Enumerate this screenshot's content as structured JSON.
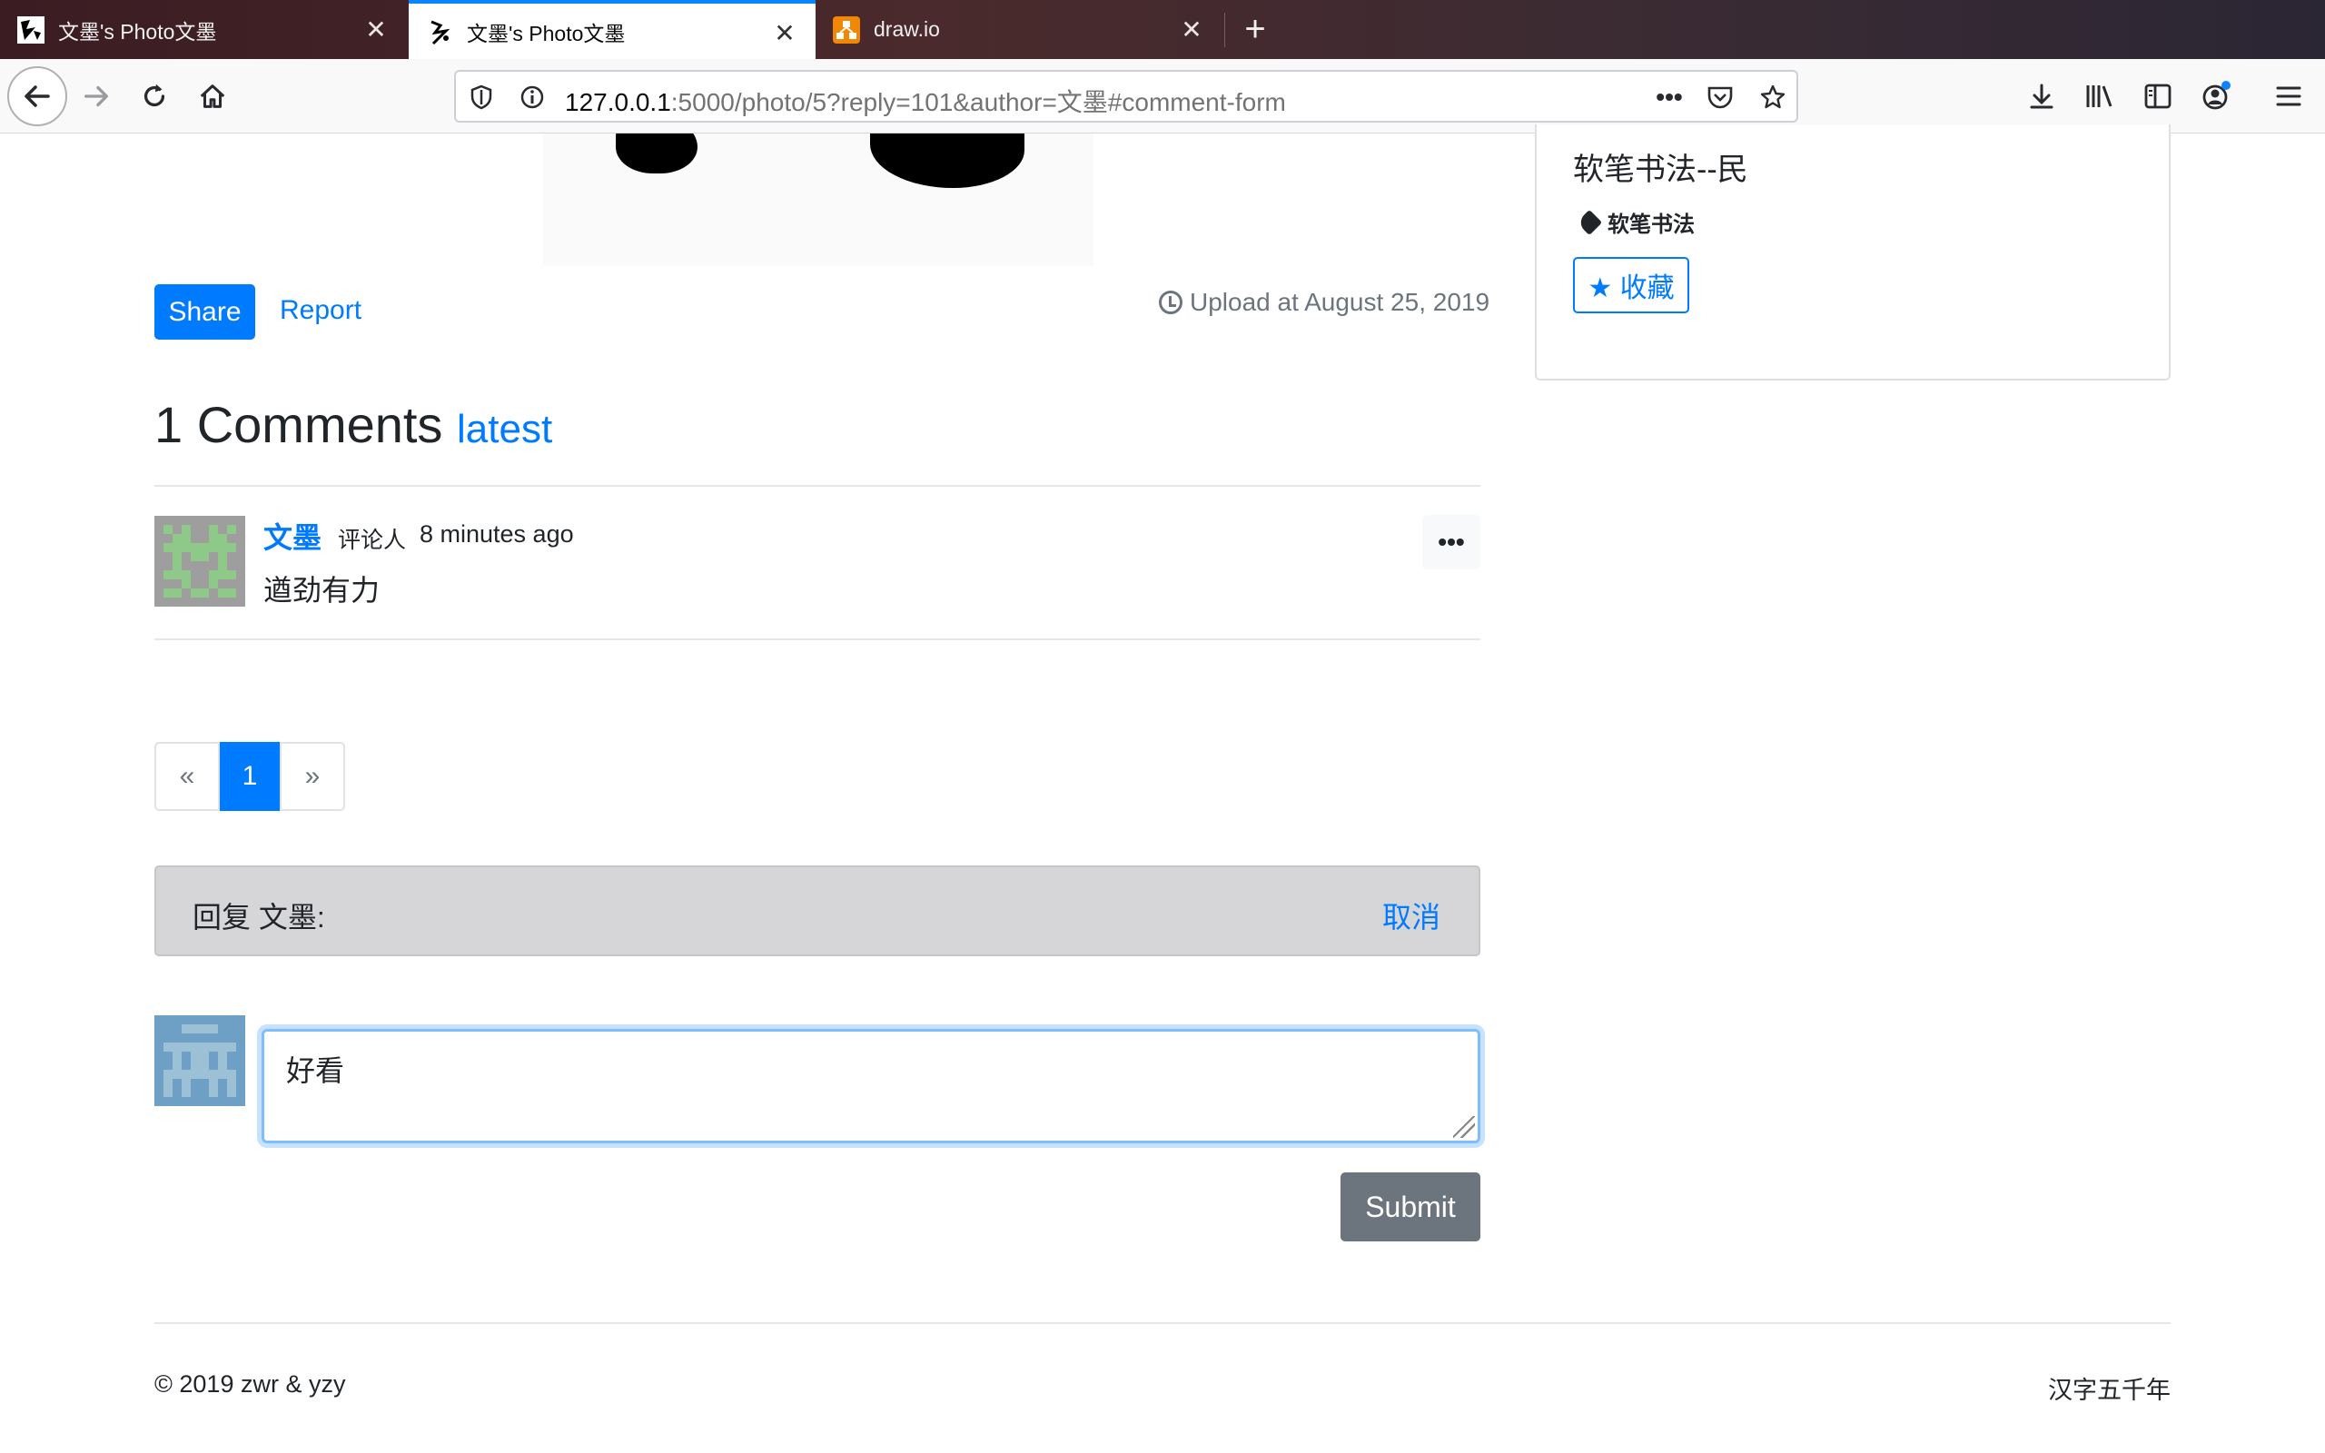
{
  "browser": {
    "tabs": [
      {
        "title": "文墨's Photo文墨",
        "favicon": "calligraphy-favicon",
        "active": false
      },
      {
        "title": "文墨's Photo文墨",
        "favicon": "calligraphy-favicon",
        "active": true
      },
      {
        "title": "draw.io",
        "favicon": "drawio-favicon",
        "active": false
      }
    ],
    "url_host": "127.0.0.1",
    "url_rest": ":5000/photo/5?reply=101&author=文墨#comment-form"
  },
  "photo": {
    "share_label": "Share",
    "report_label": "Report",
    "upload_text": "Upload at August 25, 2019"
  },
  "comments": {
    "count_title": "1 Comments",
    "sort_label": "latest",
    "items": [
      {
        "author": "文墨",
        "role": "评论人",
        "time": "8 minutes ago",
        "body": "遒劲有力",
        "more": "•••"
      }
    ]
  },
  "pagination": {
    "prev": "«",
    "current": "1",
    "next": "»"
  },
  "reply": {
    "label": "回复 文墨:",
    "cancel": "取消",
    "textarea_value": "好看",
    "submit": "Submit"
  },
  "sidebar": {
    "description": "软笔书法--民",
    "tag": "软笔书法",
    "collect_label": "★ 收藏"
  },
  "footer": {
    "left": "© 2019 zwr & yzy",
    "right": "汉字五千年"
  },
  "colors": {
    "primary": "#007bff",
    "secondary": "#6c757d"
  }
}
